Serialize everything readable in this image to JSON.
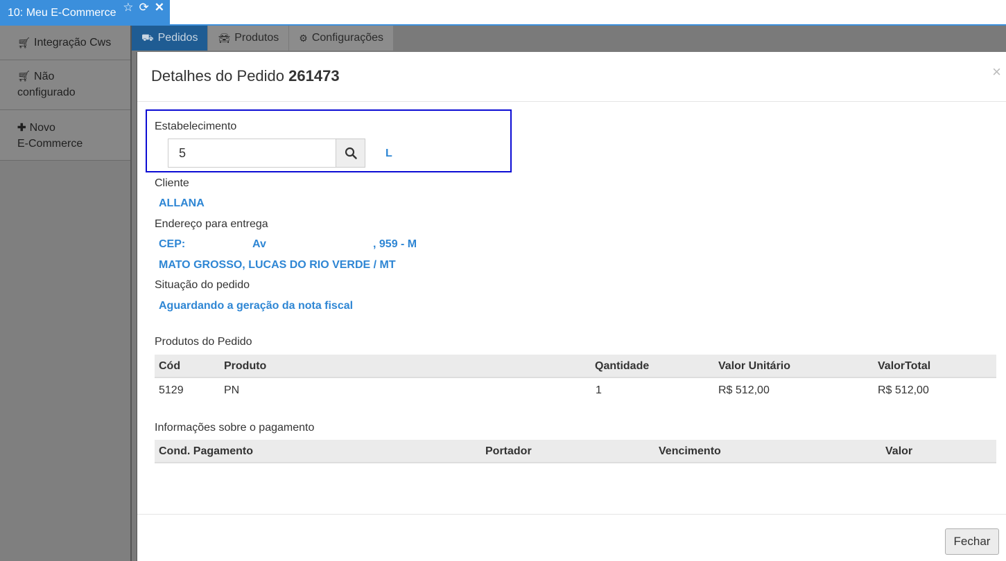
{
  "window_tab": {
    "title": "10: Meu E-Commerce",
    "icons": [
      "star-icon",
      "refresh-icon",
      "close-icon"
    ]
  },
  "sidebar": {
    "items": [
      {
        "icon": "cart-icon",
        "line1": "Integração Cws",
        "line2": ""
      },
      {
        "icon": "cart-icon",
        "line1": "Não",
        "line2": "configurado"
      },
      {
        "icon": "plus-icon",
        "line1": "Novo",
        "line2": "E-Commerce"
      }
    ]
  },
  "module_tabs": [
    {
      "icon": "truck-icon",
      "label": "Pedidos",
      "active": true
    },
    {
      "icon": "car-icon",
      "label": "Produtos",
      "active": false
    },
    {
      "icon": "gears-icon",
      "label": "Configurações",
      "active": false
    }
  ],
  "modal": {
    "title_prefix": "Detalhes do Pedido",
    "order_number": "261473",
    "close_symbol": "×",
    "estabelecimento": {
      "label": "Estabelecimento",
      "value": "5",
      "name": "L"
    },
    "cliente": {
      "label": "Cliente",
      "value": "ALLANA"
    },
    "endereco": {
      "label": "Endereço para entrega",
      "cep_label": "CEP:",
      "street_prefix": "Av",
      "number": ", 959 - M",
      "city_line": "MATO GROSSO, LUCAS DO RIO VERDE / MT"
    },
    "situacao": {
      "label": "Situação do pedido",
      "value": "Aguardando a geração da nota fiscal"
    },
    "produtos": {
      "label": "Produtos do Pedido",
      "columns": [
        "Cód",
        "Produto",
        "Qantidade",
        "Valor Unitário",
        "ValorTotal"
      ],
      "rows": [
        [
          "5129",
          "PN",
          "1",
          "R$ 512,00",
          "R$ 512,00"
        ]
      ]
    },
    "pagamento": {
      "label": "Informações sobre o pagamento",
      "columns": [
        "Cond. Pagamento",
        "Portador",
        "Vencimento",
        "Valor"
      ]
    },
    "close_button": "Fechar"
  }
}
